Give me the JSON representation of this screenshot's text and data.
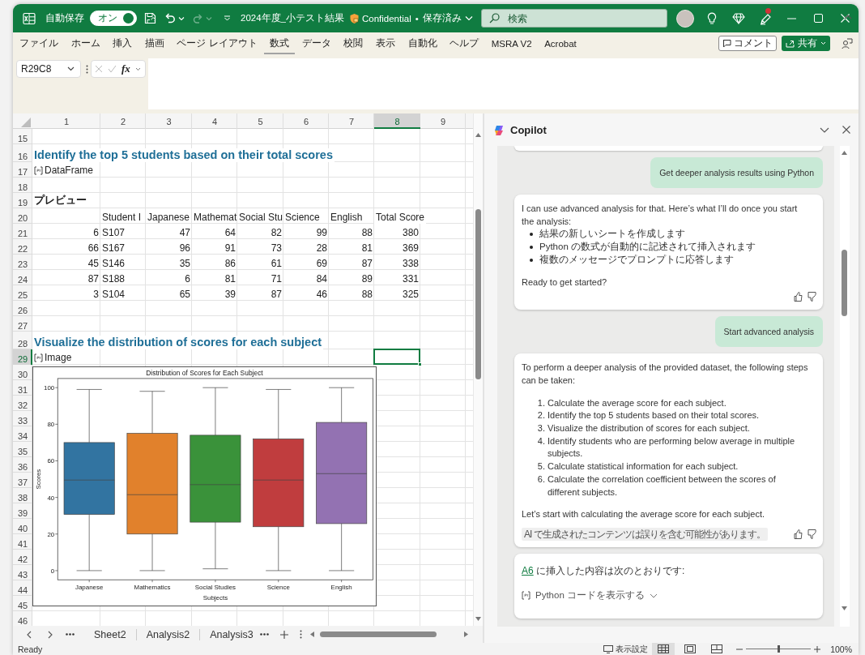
{
  "title_bar": {
    "autosave_label": "自動保存",
    "autosave_toggle": {
      "label": "オン",
      "on": true
    },
    "redo": {
      "disabled": true
    },
    "file_name": "2024年度_小テスト結果",
    "sensitivity": "Confidential",
    "separator": "•",
    "save_status": "保存済み",
    "search": {
      "placeholder": "検索"
    },
    "notification_dot": true
  },
  "ribbon": {
    "tabs": [
      {
        "label": "ファイル",
        "selected": false
      },
      {
        "label": "ホーム",
        "selected": false
      },
      {
        "label": "挿入",
        "selected": false
      },
      {
        "label": "描画",
        "selected": false
      },
      {
        "label": "ページ レイアウト",
        "selected": false
      },
      {
        "label": "数式",
        "selected": true
      },
      {
        "label": "データ",
        "selected": false
      },
      {
        "label": "校閲",
        "selected": false
      },
      {
        "label": "表示",
        "selected": false
      },
      {
        "label": "自動化",
        "selected": false
      },
      {
        "label": "ヘルプ",
        "selected": false
      },
      {
        "label": "MSRA V2",
        "selected": false
      },
      {
        "label": "Acrobat",
        "selected": false
      }
    ],
    "comment_button": "コメント",
    "share_button": "共有"
  },
  "formula_bar": {
    "name_box": "R29C8",
    "insert_function": "fx"
  },
  "sheet": {
    "columns": [
      {
        "label": "1",
        "selected": false
      },
      {
        "label": "2",
        "selected": false
      },
      {
        "label": "3",
        "selected": false
      },
      {
        "label": "4",
        "selected": false
      },
      {
        "label": "5",
        "selected": false
      },
      {
        "label": "6",
        "selected": false
      },
      {
        "label": "7",
        "selected": false
      },
      {
        "label": "8",
        "selected": true
      },
      {
        "label": "9",
        "selected": false
      }
    ],
    "rows": [
      {
        "number": "15",
        "selected": false
      },
      {
        "number": "16",
        "selected": false,
        "kind": "heading",
        "text": "Identify the top 5 students based on their total scores"
      },
      {
        "number": "17",
        "selected": false,
        "kind": "python",
        "text": "DataFrame"
      },
      {
        "number": "18",
        "selected": false
      },
      {
        "number": "19",
        "selected": false,
        "kind": "label",
        "text": "プレビュー"
      },
      {
        "number": "20",
        "selected": false,
        "kind": "table_header",
        "cells": [
          "Student I",
          "Japanese",
          "Mathemat",
          "Social Stu",
          "Science",
          "English",
          "Total Score"
        ]
      },
      {
        "number": "21",
        "selected": false,
        "kind": "table_row",
        "cells": [
          "6",
          "S107",
          "47",
          "64",
          "82",
          "99",
          "88",
          "380"
        ]
      },
      {
        "number": "22",
        "selected": false,
        "kind": "table_row",
        "cells": [
          "66",
          "S167",
          "96",
          "91",
          "73",
          "28",
          "81",
          "369"
        ]
      },
      {
        "number": "23",
        "selected": false,
        "kind": "table_row",
        "cells": [
          "45",
          "S146",
          "35",
          "86",
          "61",
          "69",
          "87",
          "338"
        ]
      },
      {
        "number": "24",
        "selected": false,
        "kind": "table_row",
        "cells": [
          "87",
          "S188",
          "6",
          "81",
          "71",
          "84",
          "89",
          "331"
        ]
      },
      {
        "number": "25",
        "selected": false,
        "kind": "table_row",
        "cells": [
          "3",
          "S104",
          "65",
          "39",
          "87",
          "46",
          "88",
          "325"
        ]
      },
      {
        "number": "26",
        "selected": false
      },
      {
        "number": "27",
        "selected": false
      },
      {
        "number": "28",
        "selected": false,
        "kind": "heading",
        "text": "Visualize the distribution of scores for each subject"
      },
      {
        "number": "29",
        "selected": true,
        "kind": "python",
        "text": "Image"
      },
      {
        "number": "30",
        "selected": false
      },
      {
        "number": "31",
        "selected": false
      },
      {
        "number": "32",
        "selected": false
      },
      {
        "number": "33",
        "selected": false
      },
      {
        "number": "34",
        "selected": false
      },
      {
        "number": "35",
        "selected": false
      },
      {
        "number": "36",
        "selected": false
      },
      {
        "number": "37",
        "selected": false
      },
      {
        "number": "38",
        "selected": false
      },
      {
        "number": "39",
        "selected": false
      },
      {
        "number": "40",
        "selected": false
      },
      {
        "number": "41",
        "selected": false
      },
      {
        "number": "42",
        "selected": false
      },
      {
        "number": "43",
        "selected": false
      },
      {
        "number": "44",
        "selected": false
      },
      {
        "number": "45",
        "selected": false
      },
      {
        "number": "46",
        "selected": false
      }
    ],
    "chart": {
      "title": "Distribution of Scores for Each Subject",
      "xlabel": "Subjects",
      "ylabel": "Scores",
      "ytick_labels": [
        "100",
        "80",
        "60",
        "40",
        "20",
        "0"
      ],
      "categories": [
        {
          "label": "Japanese",
          "color": "#3274a1"
        },
        {
          "label": "Mathematics",
          "color": "#e1812c"
        },
        {
          "label": "Social Studies",
          "color": "#3a923a"
        },
        {
          "label": "Science",
          "color": "#c03d3e"
        },
        {
          "label": "English",
          "color": "#9372b2"
        }
      ]
    }
  },
  "sheet_tabs": [
    {
      "label": "Sheet2"
    },
    {
      "label": "Analysis2"
    },
    {
      "label": "Analysis3"
    }
  ],
  "copilot": {
    "title": "Copilot",
    "messages": [
      {
        "kind": "user",
        "text": "Get deeper analysis results using Python"
      },
      {
        "kind": "assistant",
        "feedback": true,
        "blocks": [
          {
            "kind": "paragraph",
            "text": "I can use advanced analysis for that. Here’s what I’ll do once you start the analysis:"
          },
          {
            "kind": "bullets",
            "items": [
              "結果の新しいシートを作成します",
              "Python の数式が自動的に記述されて挿入されます",
              "複数のメッセージでプロンプトに応答します"
            ]
          },
          {
            "kind": "paragraph",
            "text": "Ready to get started?"
          }
        ]
      },
      {
        "kind": "user",
        "text": "Start advanced analysis"
      },
      {
        "kind": "assistant",
        "feedback": true,
        "disclaimer": "AI で生成されたコンテンツは誤りを含む可能性があります。",
        "blocks": [
          {
            "kind": "paragraph",
            "text": "To perform a deeper analysis of the provided dataset, the following steps can be taken:"
          },
          {
            "kind": "numbered",
            "items": [
              {
                "number": "1.",
                "text": "Calculate the average score for each subject."
              },
              {
                "number": "2.",
                "text": "Identify the top 5 students based on their total scores."
              },
              {
                "number": "3.",
                "text": "Visualize the distribution of scores for each subject."
              },
              {
                "number": "4.",
                "text": "Identify students who are performing below average in multiple subjects."
              },
              {
                "number": "5.",
                "text": "Calculate statistical information for each subject."
              },
              {
                "number": "6.",
                "text": "Calculate the correlation coefficient between the scores of different subjects."
              }
            ]
          },
          {
            "kind": "paragraph",
            "text": "Let’s start with calculating the average score for each subject."
          }
        ]
      },
      {
        "kind": "assistant",
        "feedback": false,
        "blocks": [
          {
            "kind": "cell_link",
            "link": "A6",
            "text": "に挿入した内容は次のとおりです:"
          },
          {
            "kind": "code_toggle",
            "text": "Python コードを表示する"
          }
        ]
      }
    ]
  },
  "status_bar": {
    "status": "Ready",
    "display_settings": "表示設定",
    "views": [
      {
        "kind": "normal",
        "selected": true
      },
      {
        "kind": "page_layout",
        "selected": false
      },
      {
        "kind": "page_break",
        "selected": false
      }
    ],
    "zoom": {
      "level": 0.5
    },
    "zoom_label": "100%"
  }
}
